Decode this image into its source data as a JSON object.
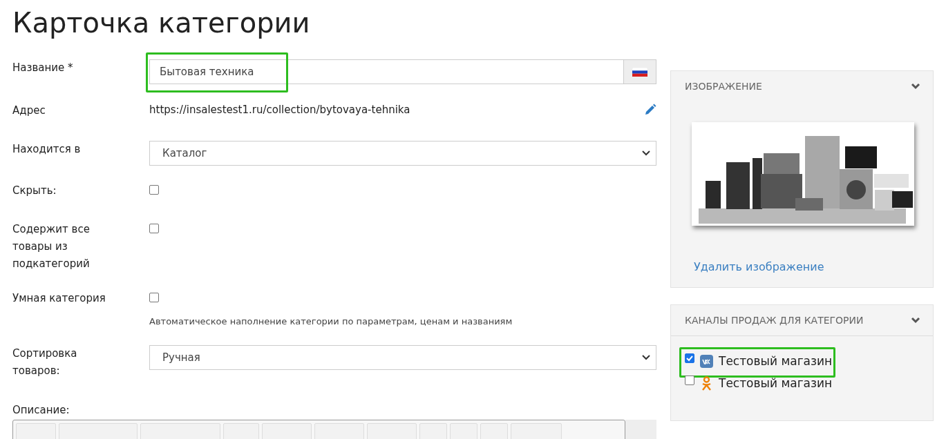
{
  "title": "Карточка категории",
  "fields": [
    {
      "kind": "text",
      "label": "Название *",
      "value": "Бытовая техника",
      "highlighted": true
    },
    {
      "kind": "url",
      "label": "Адрес",
      "value": "https://insalestest1.ru/collection/bytovaya-tehnika"
    },
    {
      "kind": "select",
      "label": "Находится в",
      "value": "Каталог"
    },
    {
      "kind": "checkbox",
      "label": "Скрыть:",
      "checked": false
    },
    {
      "kind": "checkbox",
      "label": "Содержит все товары из подкатегорий",
      "checked": false
    },
    {
      "kind": "checkbox",
      "label": "Умная категория",
      "checked": false,
      "hint": "Автоматическое наполнение категории по параметрам, ценам и названиям"
    },
    {
      "kind": "select",
      "label": "Сортировка товаров:",
      "value": "Ручная"
    }
  ],
  "description": {
    "label": "Описание:"
  },
  "image_panel": {
    "title": "ИЗОБРАЖЕНИЕ",
    "expanded": true,
    "delete_link": "Удалить изображение"
  },
  "channels_panel": {
    "title": "КАНАЛЫ ПРОДАЖ ДЛЯ КАТЕГОРИИ",
    "expanded": true,
    "items": [
      {
        "kind": "vk",
        "label": "Тестовый магазин",
        "checked": true,
        "highlighted": true
      },
      {
        "kind": "ok",
        "label": "Тестовый магазин",
        "checked": false,
        "highlighted": false
      }
    ]
  }
}
